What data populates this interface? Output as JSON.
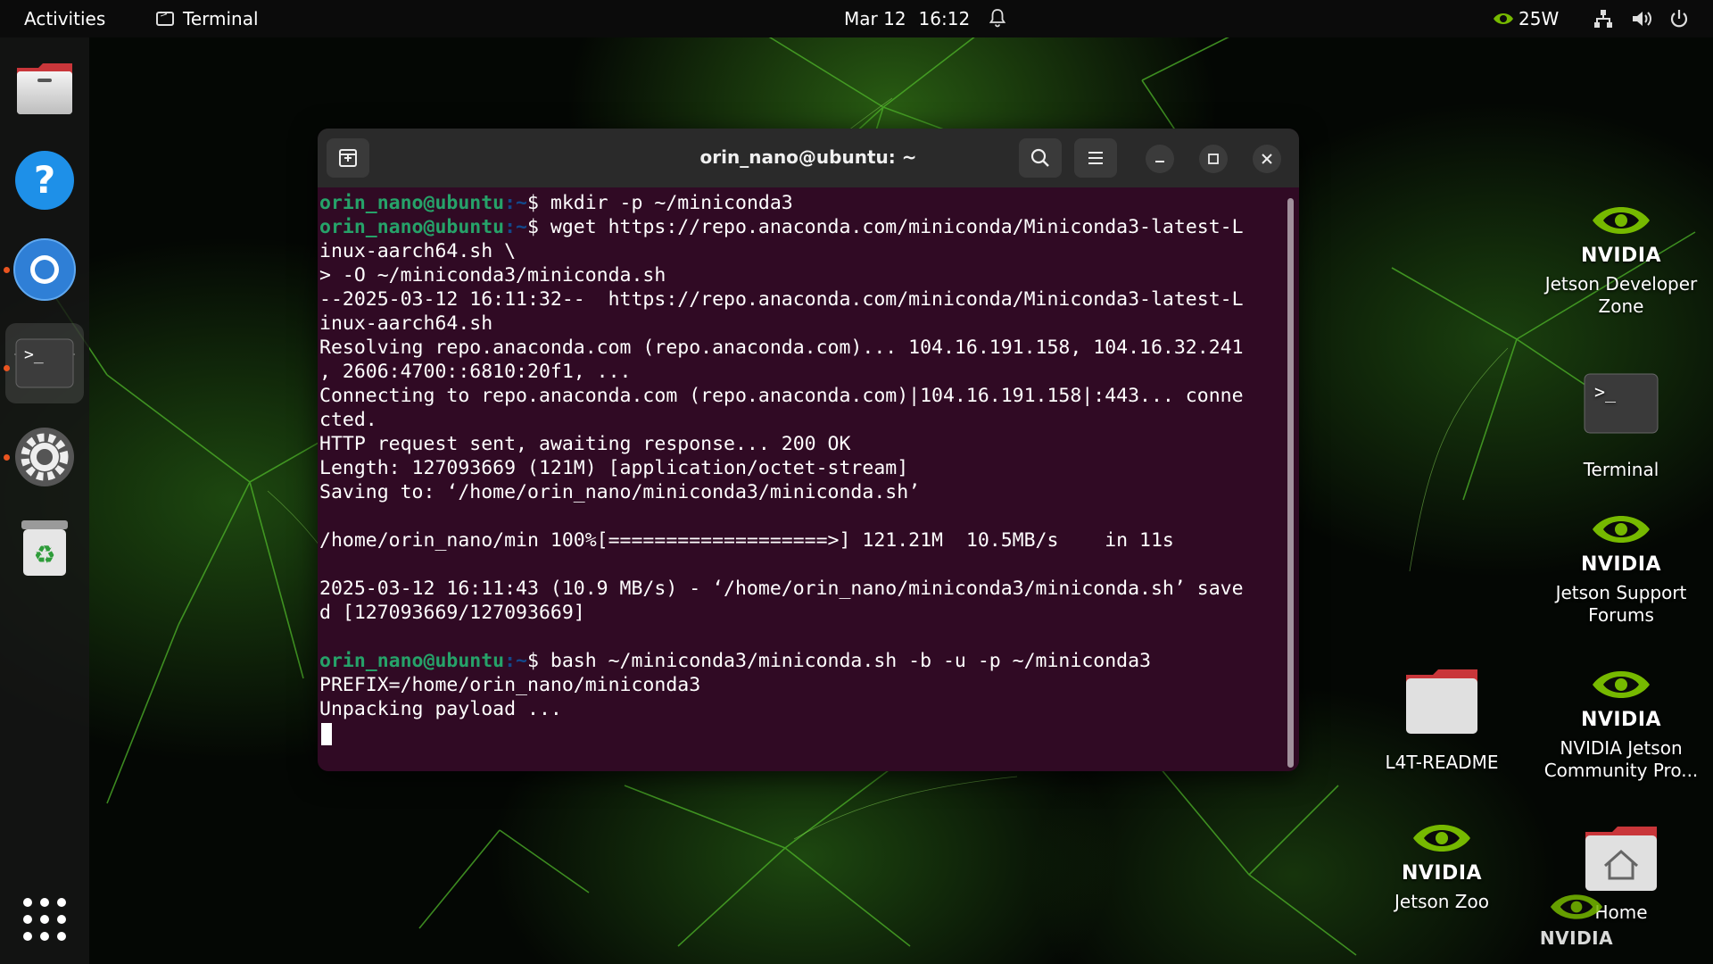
{
  "topbar": {
    "activities": "Activities",
    "app_name": "Terminal",
    "date": "Mar 12",
    "time": "16:12",
    "power_draw": "25W"
  },
  "dock": {
    "icons": [
      "files-icon",
      "help-icon",
      "chromium-icon",
      "terminal-icon",
      "settings-icon",
      "trash-icon",
      "app-grid-icon"
    ]
  },
  "terminal": {
    "title": "orin_nano@ubuntu: ~",
    "prompt_user": "orin_nano@ubuntu",
    "prompt_path": ":~",
    "prompt_symbol": "$ ",
    "lines": [
      {
        "type": "cmd",
        "text": "mkdir -p ~/miniconda3"
      },
      {
        "type": "cmd",
        "text": "wget https://repo.anaconda.com/miniconda/Miniconda3-latest-L"
      },
      {
        "type": "out",
        "text": "inux-aarch64.sh \\"
      },
      {
        "type": "out",
        "text": "> -O ~/miniconda3/miniconda.sh"
      },
      {
        "type": "out",
        "text": "--2025-03-12 16:11:32--  https://repo.anaconda.com/miniconda/Miniconda3-latest-L"
      },
      {
        "type": "out",
        "text": "inux-aarch64.sh"
      },
      {
        "type": "out",
        "text": "Resolving repo.anaconda.com (repo.anaconda.com)... 104.16.191.158, 104.16.32.241"
      },
      {
        "type": "out",
        "text": ", 2606:4700::6810:20f1, ..."
      },
      {
        "type": "out",
        "text": "Connecting to repo.anaconda.com (repo.anaconda.com)|104.16.191.158|:443... conne"
      },
      {
        "type": "out",
        "text": "cted."
      },
      {
        "type": "out",
        "text": "HTTP request sent, awaiting response... 200 OK"
      },
      {
        "type": "out",
        "text": "Length: 127093669 (121M) [application/octet-stream]"
      },
      {
        "type": "out",
        "text": "Saving to: ‘/home/orin_nano/miniconda3/miniconda.sh’"
      },
      {
        "type": "out",
        "text": ""
      },
      {
        "type": "out",
        "text": "/home/orin_nano/min 100%[===================>] 121.21M  10.5MB/s    in 11s"
      },
      {
        "type": "out",
        "text": ""
      },
      {
        "type": "out",
        "text": "2025-03-12 16:11:43 (10.9 MB/s) - ‘/home/orin_nano/miniconda3/miniconda.sh’ save"
      },
      {
        "type": "out",
        "text": "d [127093669/127093669]"
      },
      {
        "type": "out",
        "text": ""
      },
      {
        "type": "cmd",
        "text": "bash ~/miniconda3/miniconda.sh -b -u -p ~/miniconda3"
      },
      {
        "type": "out",
        "text": "PREFIX=/home/orin_nano/miniconda3"
      },
      {
        "type": "out",
        "text": "Unpacking payload ..."
      },
      {
        "type": "cursor",
        "text": ""
      }
    ]
  },
  "desktop": {
    "jetson_dev_zone": "Jetson Developer Zone",
    "terminal": "Terminal",
    "jetson_support": "Jetson Support Forums",
    "l4t_readme": "L4T-README",
    "community": "NVIDIA Jetson Community Pro...",
    "jetson_zoo": "Jetson Zoo",
    "home": "Home",
    "nvidia_word": "NVIDIA"
  },
  "colors": {
    "terminal_bg": "#300a24",
    "prompt_user": "#26a269",
    "prompt_path": "#12488b",
    "accent": "#e95420",
    "nvidia_green": "#76b900"
  }
}
